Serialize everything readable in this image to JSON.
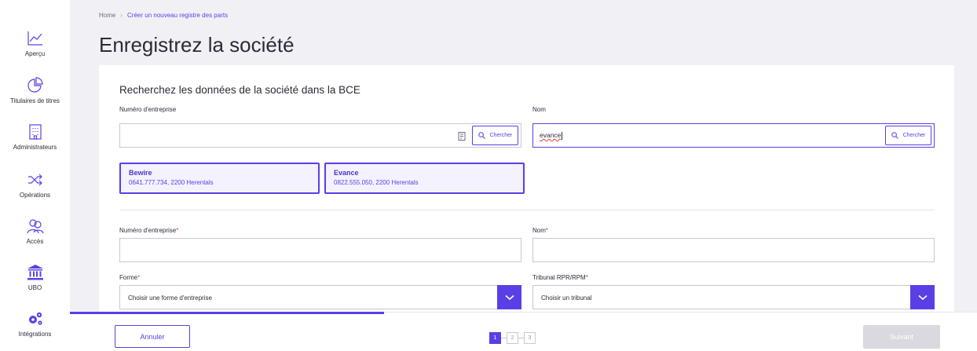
{
  "sidebar": {
    "items": [
      {
        "label": "Aperçu",
        "icon": "chart-line-icon"
      },
      {
        "label": "Titulaires de titres",
        "icon": "pie-chart-icon"
      },
      {
        "label": "Administrateurs",
        "icon": "building-icon"
      },
      {
        "label": "Opérations",
        "icon": "shuffle-icon"
      },
      {
        "label": "Accès",
        "icon": "users-icon"
      },
      {
        "label": "UBO",
        "icon": "bank-icon"
      },
      {
        "label": "Intégrations",
        "icon": "cogs-icon"
      }
    ]
  },
  "breadcrumb": {
    "home": "Home",
    "current": "Créer un nouveau registre des parts"
  },
  "page_title": "Enregistrez la société",
  "search": {
    "title": "Recherchez les données de la société dans la BCE",
    "number_label": "Numéro d'entreprise",
    "number_value": "",
    "name_label": "Nom",
    "name_value": "evance",
    "button_label": "Chercher"
  },
  "results": [
    {
      "name": "Bewire",
      "details": "0641.777.734, 2200 Herentals"
    },
    {
      "name": "Evance",
      "details": "0822.555.050, 2200 Herentals"
    }
  ],
  "form": {
    "number_label": "Numéro d'entreprise",
    "name_label": "Nom",
    "forme_label": "Forme",
    "forme_placeholder": "Choisir une forme d'entreprise",
    "tribunal_label": "Tribunal RPR/RPM",
    "tribunal_placeholder": "Choisir un tribunal",
    "required_marker": "*"
  },
  "footer": {
    "cancel_label": "Annuler",
    "next_label": "Suivant",
    "steps": [
      "1",
      "2",
      "3"
    ],
    "current_step": 1
  },
  "colors": {
    "accent": "#5a3fe6",
    "required": "#e23a3a",
    "background": "#f1f1f5",
    "disabled": "#d9d9df"
  }
}
